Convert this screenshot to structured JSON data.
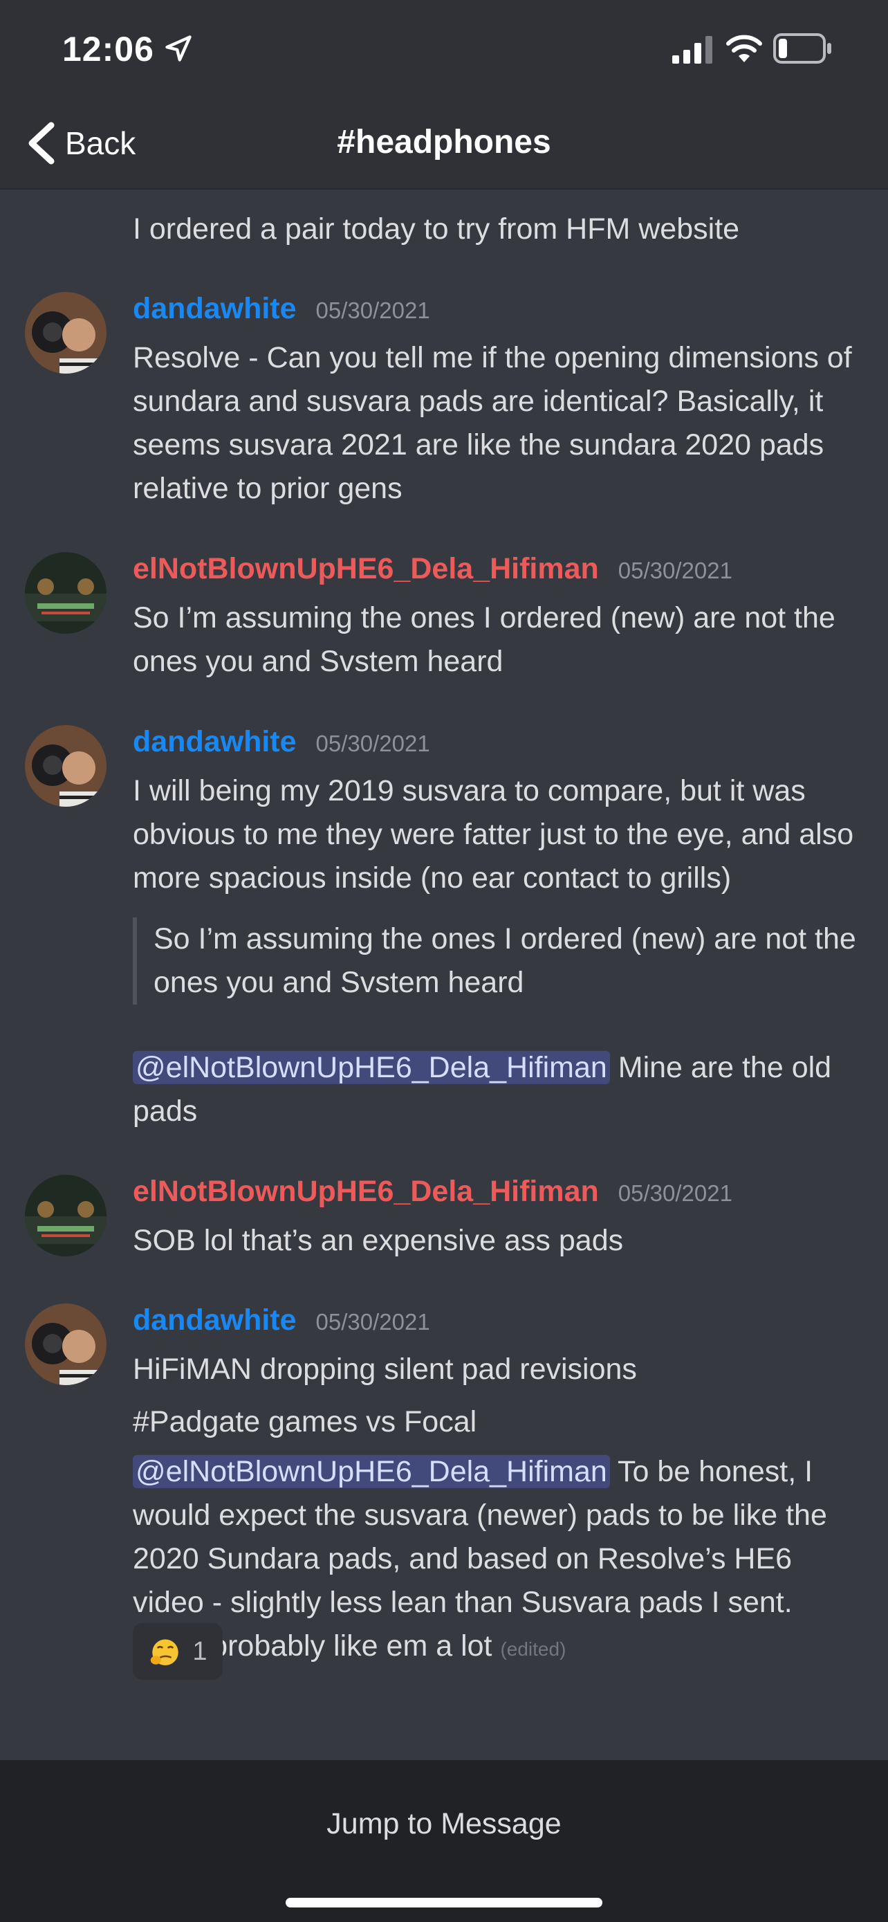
{
  "status_bar": {
    "time": "12:06"
  },
  "header": {
    "back_label": "Back",
    "channel": "#headphones"
  },
  "messages": {
    "m0": {
      "text": "I ordered a pair today to try from HFM website"
    },
    "m1": {
      "user": "dandawhite",
      "user_color": "#1a88f2",
      "timestamp": "05/30/2021",
      "text": "Resolve - Can you tell me if the opening dimensions of sundara and susvara pads are identical? Basically, it seems susvara 2021 are like the sundara 2020 pads relative to prior gens"
    },
    "m2": {
      "user": "elNotBlownUpHE6_Dela_Hifiman",
      "user_color": "#ed5a5a",
      "timestamp": "05/30/2021",
      "text": "So I’m assuming the ones I ordered (new) are not the ones you and Svstem heard"
    },
    "m3": {
      "user": "dandawhite",
      "timestamp": "05/30/2021",
      "text": "I will being my 2019 susvara to compare, but it was obvious to me they were fatter just to the eye, and also more spacious inside (no ear contact to grills)",
      "quote": "So I’m assuming the ones I ordered (new) are not the ones you and Svstem heard",
      "mention": "@elNotBlownUpHE6_Dela_Hifiman",
      "reply_text": " Mine are the old pads"
    },
    "m4": {
      "user": "elNotBlownUpHE6_Dela_Hifiman",
      "timestamp": "05/30/2021",
      "text": "SOB lol that’s an expensive ass pads"
    },
    "m5": {
      "user": "dandawhite",
      "timestamp": "05/30/2021",
      "line1": "HiFiMAN dropping silent pad revisions",
      "line2": "#Padgate games vs Focal",
      "mention": "@elNotBlownUpHE6_Dela_Hifiman",
      "text": " To be honest, I would expect the susvara (newer) pads to be like the 2020 Sundara pads, and based on Resolve’s HE6 video - slightly less lean than Susvara pads I sent. You’ll probably like em a lot",
      "edited": "(edited)",
      "reaction": {
        "emoji": "smirk-face-icon",
        "count": "1"
      }
    }
  },
  "footer": {
    "jump_label": "Jump to Message"
  }
}
